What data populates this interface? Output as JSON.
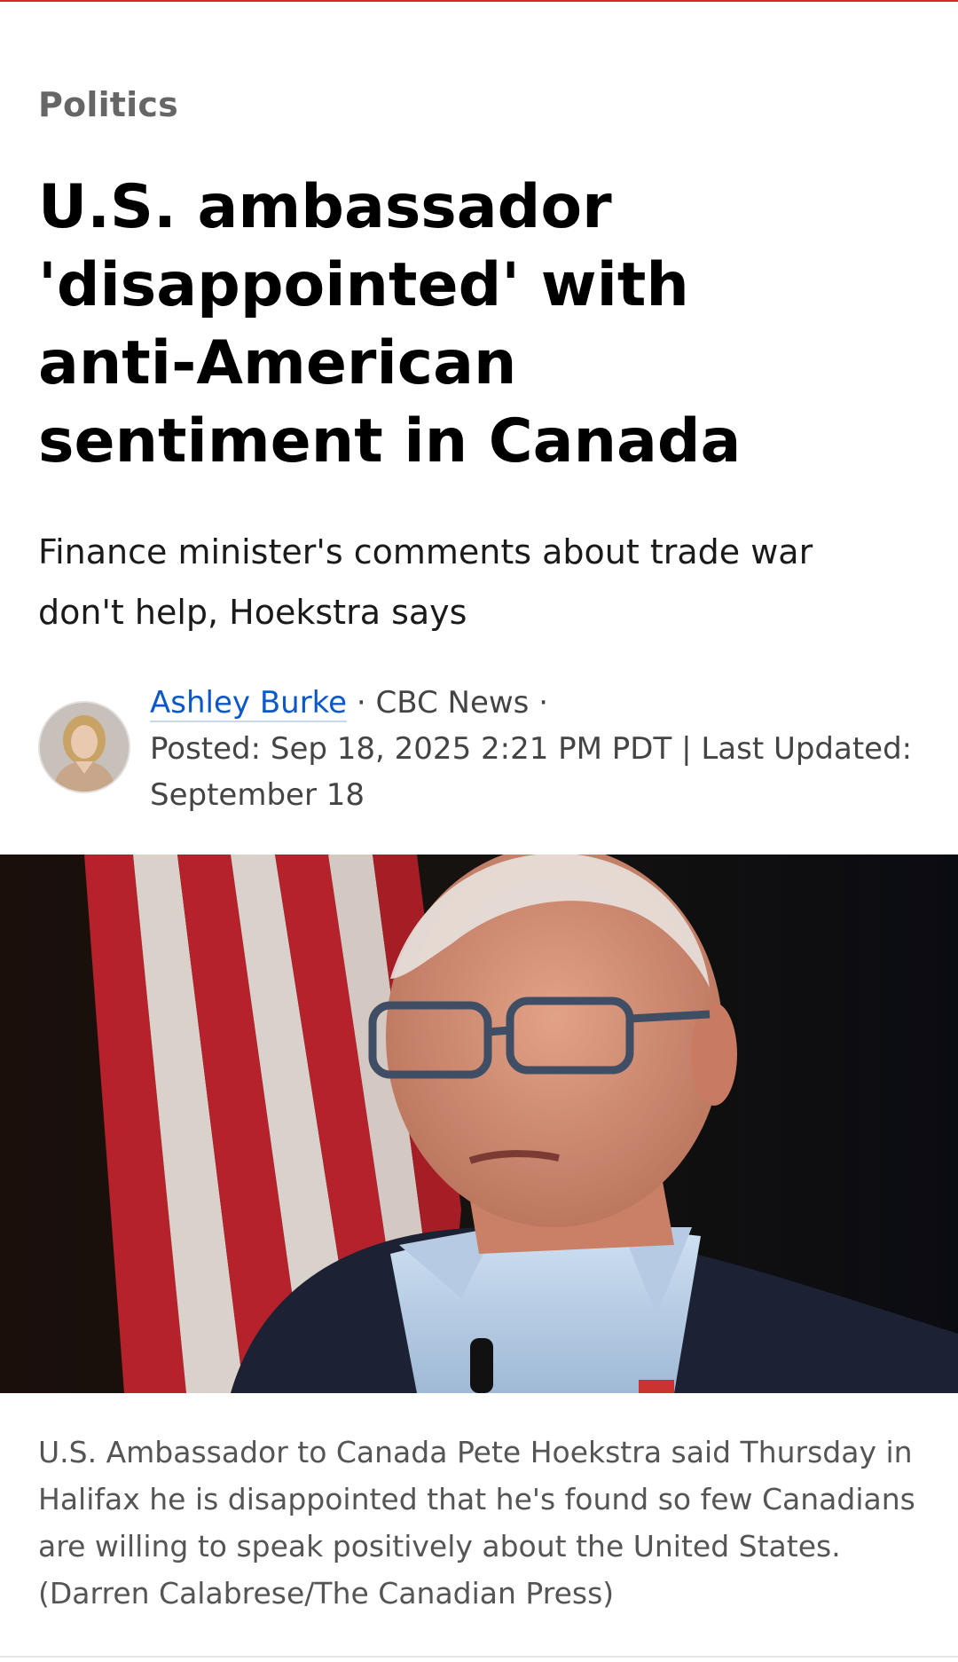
{
  "article": {
    "section": "Politics",
    "headline": "U.S. ambassador 'disappointed' with anti-American sentiment in Canada",
    "deck": "Finance minister's comments about trade war don't help, Hoekstra says",
    "byline": {
      "author": "Ashley Burke",
      "sep1": " · ",
      "outlet": "CBC News",
      "sep2": " ·",
      "posted": "Posted: Sep 18, 2025 2:21 PM PDT | Last Updated: September 18"
    },
    "image": {
      "caption": "U.S. Ambassador to Canada Pete Hoekstra said Thursday in Halifax he is disappointed that he's found so few Canadians are willing to speak positively about the United States. (Darren Calabrese/The Canadian Press)"
    }
  },
  "colors": {
    "accent_red": "#d9262e",
    "link_blue": "#0a58c9",
    "section_gray": "#666666"
  }
}
